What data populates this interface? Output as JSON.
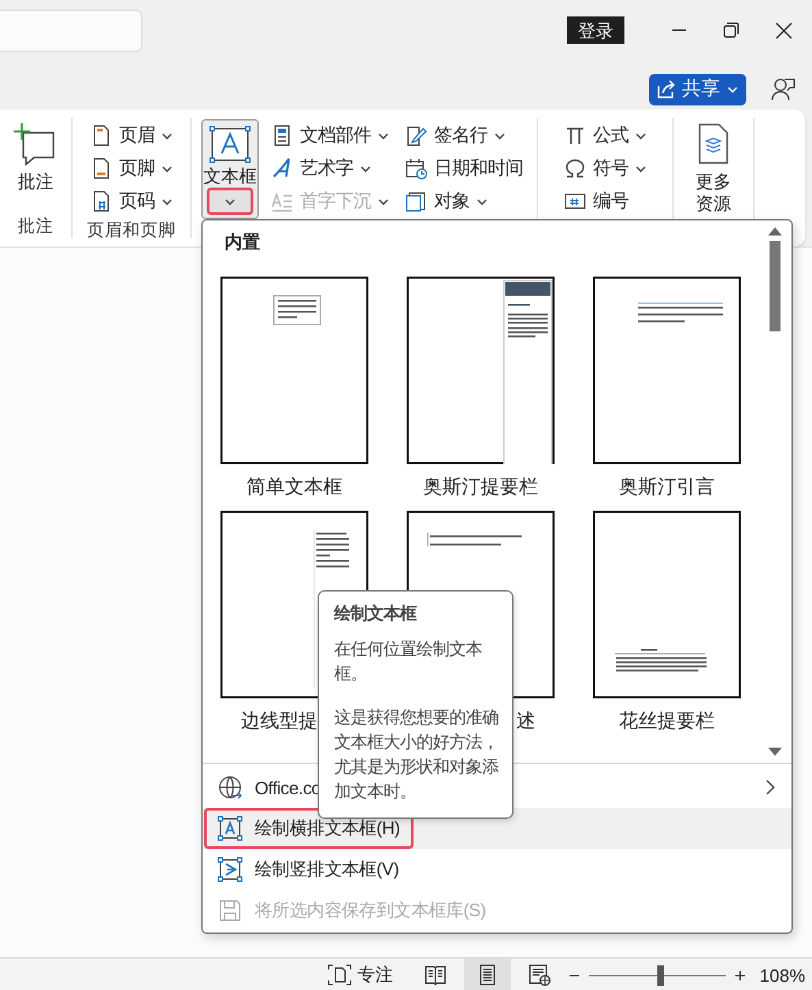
{
  "title_bar": {
    "sign_in": "登录"
  },
  "share_button": {
    "label": "共享"
  },
  "ribbon": {
    "groups": [
      {
        "label": "批注",
        "items": [
          {
            "kind": "large",
            "label": "批注"
          }
        ]
      },
      {
        "label": "页眉和页脚",
        "items": [
          {
            "kind": "small",
            "label": "页眉",
            "menu": true,
            "disabled": false
          },
          {
            "kind": "small",
            "label": "页脚",
            "menu": true,
            "disabled": false
          },
          {
            "kind": "small",
            "label": "页码",
            "menu": true,
            "disabled": false
          }
        ]
      },
      {
        "items": [
          {
            "kind": "split",
            "label": "文本框",
            "selected": true,
            "menu_open": true
          },
          {
            "kind": "small",
            "label": "文档部件",
            "menu": true,
            "disabled": false
          },
          {
            "kind": "small",
            "label": "艺术字",
            "menu": true,
            "disabled": false
          },
          {
            "kind": "small",
            "label": "首字下沉",
            "menu": true,
            "disabled": true
          },
          {
            "kind": "small",
            "label": "签名行",
            "menu": true,
            "disabled": false
          },
          {
            "kind": "small",
            "label": "日期和时间",
            "menu": false,
            "disabled": false
          },
          {
            "kind": "small",
            "label": "对象",
            "menu": true,
            "disabled": false
          }
        ]
      },
      {
        "items": [
          {
            "kind": "small",
            "label": "公式",
            "menu": true,
            "disabled": false
          },
          {
            "kind": "small",
            "label": "符号",
            "menu": true,
            "disabled": false
          },
          {
            "kind": "small",
            "label": "编号",
            "menu": false,
            "disabled": false
          }
        ]
      },
      {
        "items": [
          {
            "kind": "large",
            "label": "更多资源"
          }
        ]
      }
    ]
  },
  "textbox_menu": {
    "heading": "内置",
    "gallery": [
      {
        "label": "简单文本框",
        "kind": "simple"
      },
      {
        "label": "奥斯汀提要栏",
        "kind": "sidebar"
      },
      {
        "label": "奥斯汀引言",
        "kind": "quote"
      },
      {
        "label": "边线型提",
        "kind": "side-line"
      },
      {
        "label": "述",
        "kind": "quote-left"
      },
      {
        "label": "花丝提要栏",
        "kind": "bottom"
      }
    ],
    "commands": [
      {
        "label": "Office.co",
        "submenu": true,
        "selected": false,
        "disabled": false
      },
      {
        "label": "绘制横排文本框(H)",
        "submenu": false,
        "selected": true,
        "disabled": false
      },
      {
        "label": "绘制竖排文本框(V)",
        "submenu": false,
        "selected": false,
        "disabled": false
      },
      {
        "label": "将所选内容保存到文本框库(S)",
        "submenu": false,
        "selected": false,
        "disabled": true
      }
    ]
  },
  "tooltip": {
    "title": "绘制文本框",
    "paragraphs": [
      "在任何位置绘制文本框。",
      "这是获得您想要的准确文本框大小的好方法，尤其是为形状和对象添加文本时。"
    ]
  },
  "status_bar": {
    "focus": "专注",
    "views": [
      {
        "selected": false
      },
      {
        "selected": true
      },
      {
        "selected": false
      }
    ],
    "zoom": {
      "level": 0.52,
      "reading": "108%"
    }
  }
}
